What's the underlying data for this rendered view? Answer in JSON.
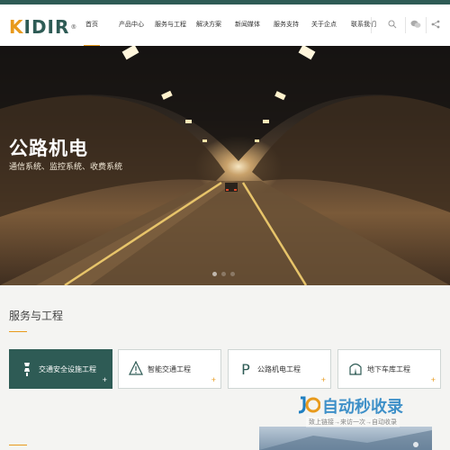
{
  "brand": {
    "logo_k": "K",
    "logo_rest": "IDIR",
    "reg": "®"
  },
  "nav": {
    "items": [
      {
        "label": "首页",
        "active": true
      },
      {
        "label": "产品中心"
      },
      {
        "label": "服务与工程"
      },
      {
        "label": "解决方案"
      },
      {
        "label": "新闻媒体"
      },
      {
        "label": "服务支持"
      },
      {
        "label": "关于企点"
      },
      {
        "label": "联系我们"
      }
    ],
    "icons": [
      "search-icon",
      "wechat-icon",
      "share-icon"
    ]
  },
  "hero": {
    "title": "公路机电",
    "subtitle": "通信系统、监控系统、收费系统",
    "slides": 3,
    "active_slide": 1
  },
  "services": {
    "title": "服务与工程",
    "cards": [
      {
        "label": "交通安全设施工程",
        "icon": "safety-icon",
        "active": true,
        "plus": "+"
      },
      {
        "label": "智能交通工程",
        "icon": "warning-sign-icon",
        "plus": "+"
      },
      {
        "label": "公路机电工程",
        "icon": "parking-p-icon",
        "plus": "+"
      },
      {
        "label": "地下车库工程",
        "icon": "tunnel-icon",
        "plus": "+"
      }
    ]
  },
  "watermark": {
    "big": "自动秒收录",
    "small": "致上链接→来访一次→自动收录"
  },
  "colors": {
    "primary": "#2e5b55",
    "accent": "#e89a1c"
  }
}
